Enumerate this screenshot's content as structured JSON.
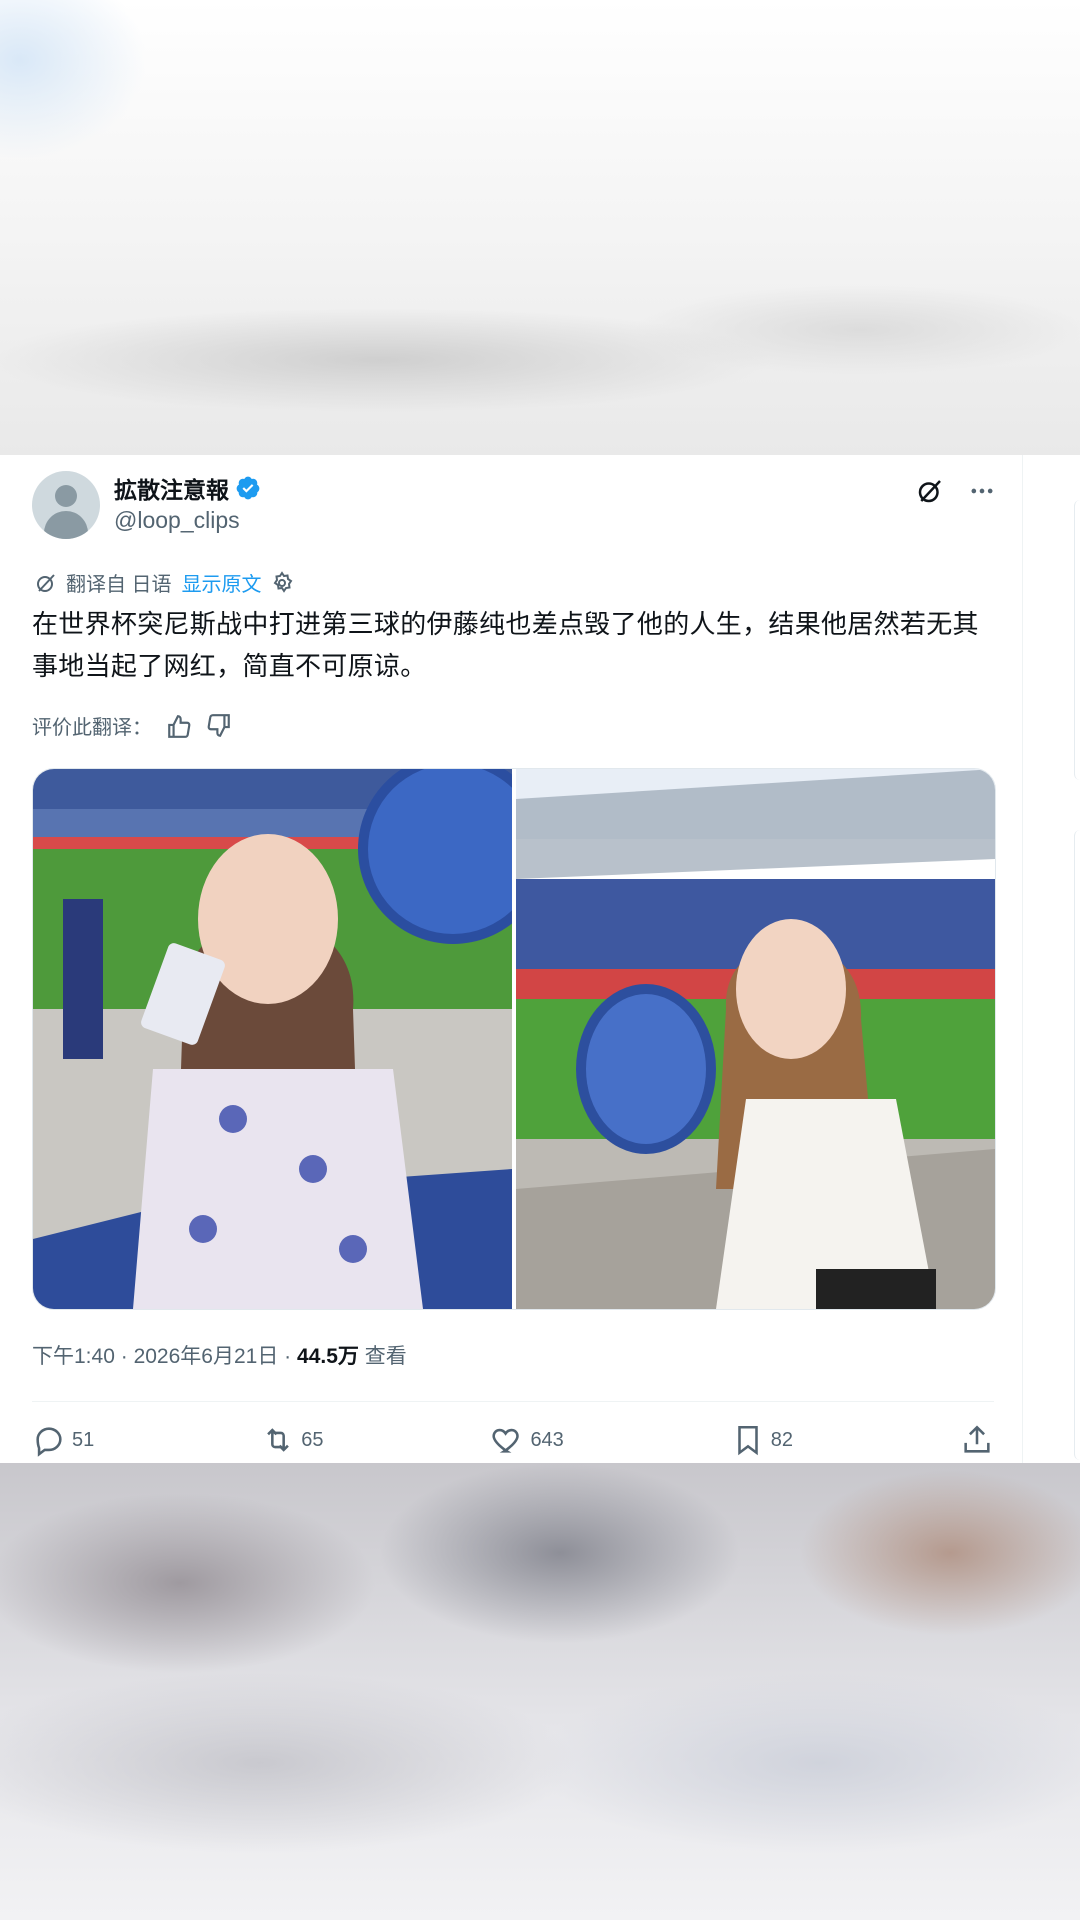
{
  "tweet": {
    "author_name": "拡散注意報",
    "handle": "@loop_clips",
    "translate": {
      "from_label": "翻译自 日语",
      "show_original": "显示原文"
    },
    "text": "在世界杯突尼斯战中打进第三球的伊藤纯也差点毁了他的人生，结果他居然若无其事地当起了网红，简直不可原谅。",
    "rate_label": "评价此翻译：",
    "time": "下午1:40",
    "date": "2026年6月21日",
    "views_count": "44.5万",
    "views_label": "查看",
    "sep": "·",
    "replies": "51",
    "retweets": "65",
    "likes": "643",
    "bookmarks": "82"
  },
  "icons": [
    "grok-icon",
    "more-icon",
    "translate-icon",
    "settings-icon",
    "thumbs-up-icon",
    "thumbs-down-icon",
    "reply-icon",
    "retweet-icon",
    "like-icon",
    "bookmark-icon",
    "share-icon",
    "verified-icon"
  ],
  "colors": {
    "accent": "#1d9bf0",
    "text": "#0f1419",
    "secondary": "#536471"
  }
}
